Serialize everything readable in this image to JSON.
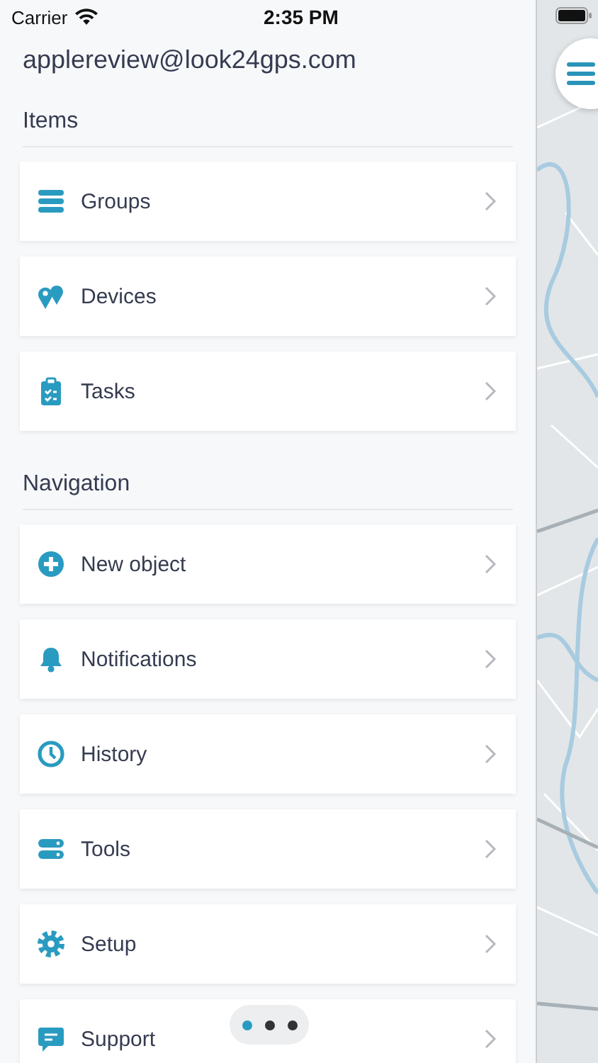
{
  "status_bar": {
    "carrier": "Carrier",
    "time": "2:35 PM"
  },
  "account": {
    "email": "applereview@look24gps.com"
  },
  "sections": [
    {
      "title": "Items",
      "items": [
        {
          "label": "Groups"
        },
        {
          "label": "Devices"
        },
        {
          "label": "Tasks"
        }
      ]
    },
    {
      "title": "Navigation",
      "items": [
        {
          "label": "New object"
        },
        {
          "label": "Notifications"
        },
        {
          "label": "History"
        },
        {
          "label": "Tools"
        },
        {
          "label": "Setup"
        },
        {
          "label": "Support"
        }
      ]
    }
  ],
  "pager": [
    {
      "selected": true
    },
    {
      "selected": false
    },
    {
      "selected": false
    }
  ]
}
